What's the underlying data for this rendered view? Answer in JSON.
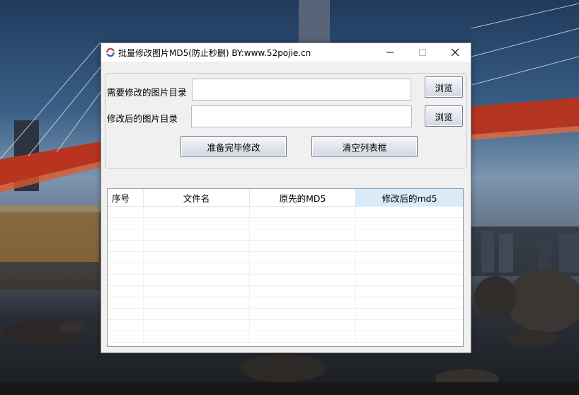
{
  "window": {
    "title": "批量修改图片MD5(防止秒删) BY:www.52pojie.cn",
    "icons": {
      "app": "app-logo-icon",
      "minimize": "minimize-icon",
      "maximize": "maximize-icon",
      "close": "close-icon"
    }
  },
  "form": {
    "source_label": "需要修改的图片目录",
    "source_value": "",
    "target_label": "修改后的图片目录",
    "target_value": "",
    "browse_source_label": "浏览",
    "browse_target_label": "浏览",
    "start_button_label": "准备完毕修改",
    "clear_button_label": "清空列表框"
  },
  "list": {
    "columns": [
      "序号",
      "文件名",
      "原先的MD5",
      "修改后的md5"
    ],
    "selected_column": 3,
    "rows": []
  },
  "colors": {
    "window_bg": "#f0f0f0",
    "header_highlight": "#d9ebf9",
    "button_border": "#6f7b8a"
  }
}
